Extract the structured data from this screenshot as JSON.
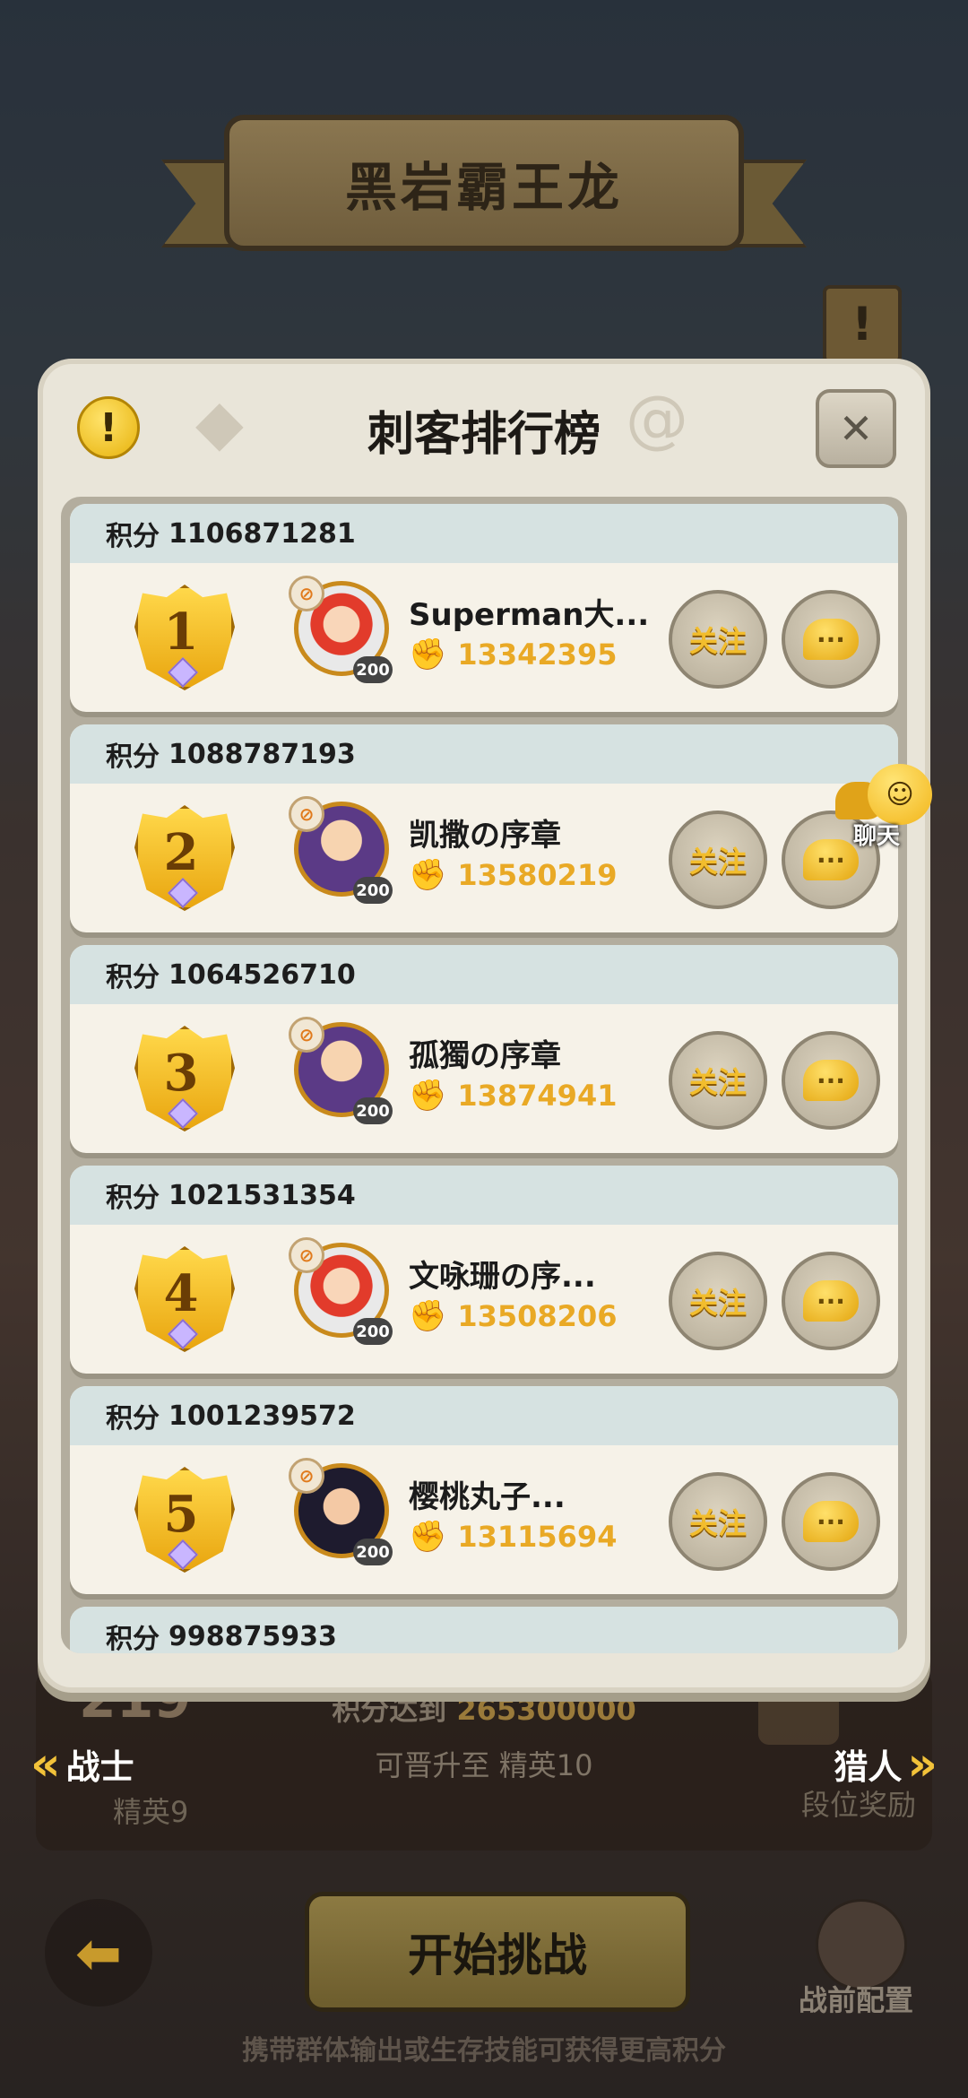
{
  "banner": {
    "title": "黑岩霸王龙"
  },
  "panel": {
    "title": "刺客排行榜",
    "info_icon": "exclamation-icon",
    "close_icon": "close-icon"
  },
  "entries": [
    {
      "score_label": "积分",
      "score": "1106871281",
      "rank": "1",
      "avatar": "white",
      "level": "200",
      "name": "Superman大...",
      "power": "13342395",
      "follow": "关注"
    },
    {
      "score_label": "积分",
      "score": "1088787193",
      "rank": "2",
      "avatar": "purple",
      "level": "200",
      "name": "凯撒の序章",
      "power": "13580219",
      "follow": "关注"
    },
    {
      "score_label": "积分",
      "score": "1064526710",
      "rank": "3",
      "avatar": "purple",
      "level": "200",
      "name": "孤獨の序章",
      "power": "13874941",
      "follow": "关注"
    },
    {
      "score_label": "积分",
      "score": "1021531354",
      "rank": "4",
      "avatar": "white",
      "level": "200",
      "name": "文咏珊の序...",
      "power": "13508206",
      "follow": "关注"
    },
    {
      "score_label": "积分",
      "score": "1001239572",
      "rank": "5",
      "avatar": "dark",
      "level": "200",
      "name": "樱桃丸子...",
      "power": "13115694",
      "follow": "关注"
    },
    {
      "score_label": "积分",
      "score": "998875933"
    }
  ],
  "float_chat": {
    "label": "聊天"
  },
  "bottom": {
    "score_value": "219",
    "target_prefix": "积分达到",
    "target_value": "265300000",
    "promote_text": "可晋升至 精英10",
    "left_nav": {
      "label": "战士",
      "sub": "精英9"
    },
    "right_nav": {
      "label": "猎人",
      "sub": "段位奖励"
    }
  },
  "footer": {
    "start_label": "开始挑战",
    "config_label": "战前配置",
    "tip": "携带群体输出或生存技能可获得更高积分"
  },
  "colors": {
    "accent_gold": "#e9a925",
    "panel_bg": "#e9e5d9",
    "card_head": "#d6e2e1"
  }
}
